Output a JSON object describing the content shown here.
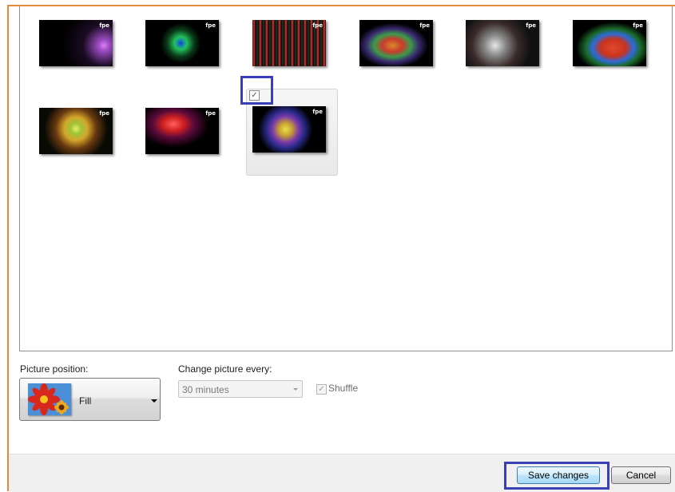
{
  "labels": {
    "picture_position": "Picture position:",
    "change_picture_every": "Change picture every:"
  },
  "picture_position": {
    "selected": "Fill"
  },
  "interval": {
    "selected": "30 minutes"
  },
  "shuffle": {
    "label": "Shuffle",
    "checked": true
  },
  "buttons": {
    "save": "Save changes",
    "cancel": "Cancel"
  },
  "gallery": {
    "thumbnails": [
      {
        "logo": "fpe",
        "colors": [
          "#000000",
          "#b65fd6"
        ]
      },
      {
        "logo": "fpe",
        "colors": [
          "#000000",
          "#21c25b"
        ]
      },
      {
        "logo": "fpe",
        "colors": [
          "#0b0b0b",
          "#d23a34"
        ]
      },
      {
        "logo": "fpe",
        "colors": [
          "#000000",
          "#c83b2d"
        ]
      },
      {
        "logo": "fpe",
        "colors": [
          "#101010",
          "#c9c9c9"
        ]
      },
      {
        "logo": "fpe",
        "colors": [
          "#000000",
          "#c8331f"
        ]
      },
      {
        "logo": "fpe",
        "colors": [
          "#0a0a05",
          "#d4a72a"
        ]
      },
      {
        "logo": "fpe",
        "colors": [
          "#000000",
          "#d02020"
        ]
      },
      {
        "logo": "fpe",
        "colors": [
          "#000000",
          "#d8c43a"
        ],
        "selected": true
      }
    ]
  },
  "colors": {
    "frame": "#e8893a",
    "highlight": "#3b3fb6"
  }
}
